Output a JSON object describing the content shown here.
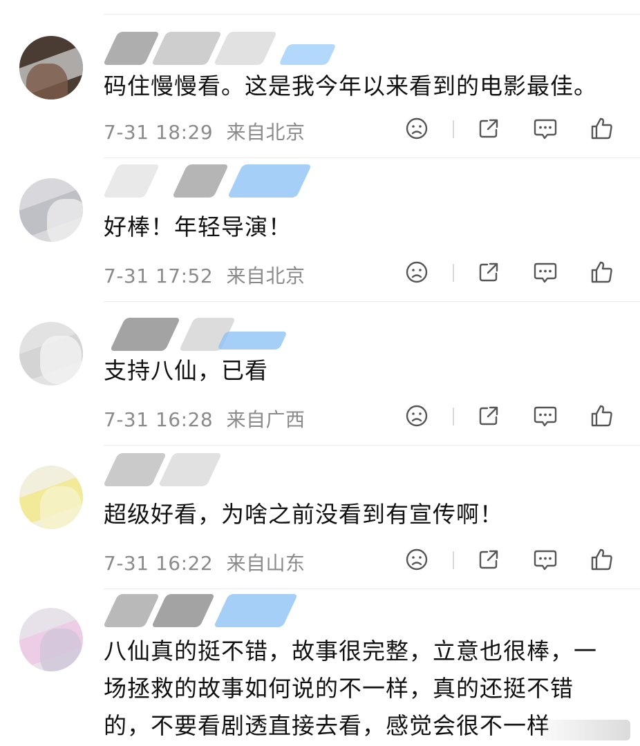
{
  "comments": [
    {
      "text": "码住慢慢看。这是我今年以来看到的电影最佳。",
      "time": "7-31 18:29",
      "location": "来自北京",
      "avatar_color": "#5a4a3e"
    },
    {
      "text": "好棒！年轻导演！",
      "time": "7-31 17:52",
      "location": "来自北京",
      "avatar_color": "#c9c9cf"
    },
    {
      "text": "支持八仙，已看",
      "time": "7-31 16:28",
      "location": "来自广西",
      "avatar_color": "#d6d6d6"
    },
    {
      "text": "超级好看，为啥之前没看到有宣传啊！",
      "time": "7-31 16:22",
      "location": "来自山东",
      "avatar_color": "#f1ea8a"
    },
    {
      "text": "八仙真的挺不错，故事很完整，立意也很棒，一场拯救的故事如何说的不一样，真的还挺不错的，不要看剧透直接去看，感觉会很不一样",
      "time": "",
      "location": "",
      "avatar_color": "#e9b9d9"
    }
  ],
  "icons": {
    "dislike": "sad-face-icon",
    "share": "share-icon",
    "reply": "comment-bubble-icon",
    "like": "thumbs-up-icon"
  },
  "colors": {
    "meta_text": "#8a8a8a",
    "blur_blue": "#8fc3f5",
    "blur_gray": "#9a9a9a"
  }
}
